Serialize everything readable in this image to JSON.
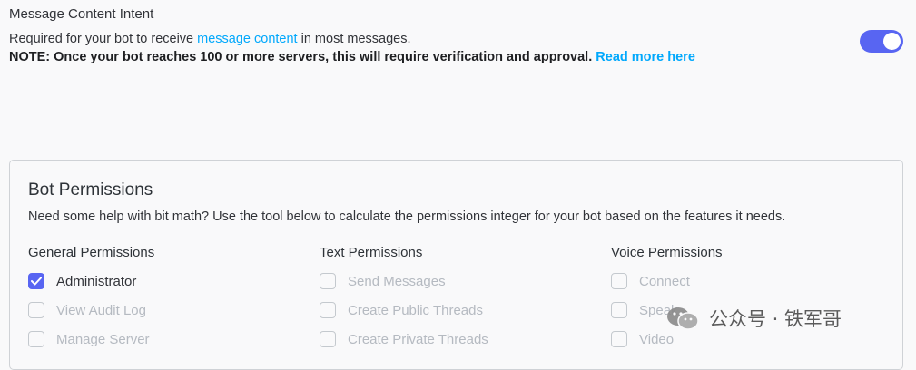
{
  "intent": {
    "title": "Message Content Intent",
    "desc_prefix": "Required for your bot to receive ",
    "desc_link": "message content",
    "desc_suffix": " in most messages.",
    "note": "NOTE: Once your bot reaches 100 or more servers, this will require verification and approval.",
    "note_link": "Read more here",
    "toggle_on": true,
    "accent_color": "#5865f2",
    "link_color": "#00a8fc"
  },
  "bot_permissions": {
    "title": "Bot Permissions",
    "desc": "Need some help with bit math? Use the tool below to calculate the permissions integer for your bot based on the features it needs.",
    "columns": [
      {
        "heading": "General Permissions",
        "items": [
          {
            "label": "Administrator",
            "checked": true
          },
          {
            "label": "View Audit Log",
            "checked": false
          },
          {
            "label": "Manage Server",
            "checked": false
          }
        ]
      },
      {
        "heading": "Text Permissions",
        "items": [
          {
            "label": "Send Messages",
            "checked": false
          },
          {
            "label": "Create Public Threads",
            "checked": false
          },
          {
            "label": "Create Private Threads",
            "checked": false
          }
        ]
      },
      {
        "heading": "Voice Permissions",
        "items": [
          {
            "label": "Connect",
            "checked": false
          },
          {
            "label": "Speak",
            "checked": false
          },
          {
            "label": "Video",
            "checked": false
          }
        ]
      }
    ]
  },
  "watermark": {
    "text": "公众号 · 铁军哥",
    "icon": "wechat-icon"
  }
}
